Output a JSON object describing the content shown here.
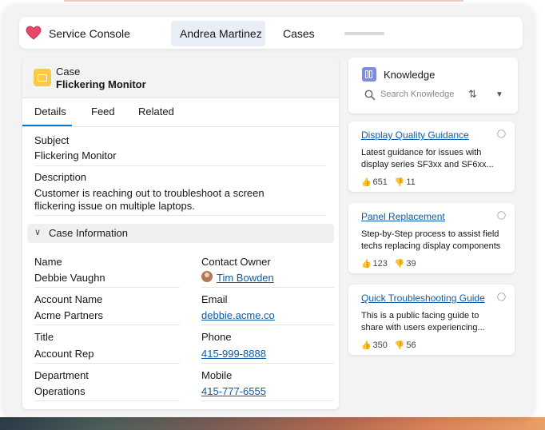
{
  "nav": {
    "app_name": "Service Console",
    "tabs": [
      {
        "label": "Andrea Martinez",
        "active": true
      },
      {
        "label": "Cases",
        "active": false
      }
    ]
  },
  "case": {
    "type": "Case",
    "title": "Flickering Monitor",
    "tabs": [
      "Details",
      "Feed",
      "Related"
    ],
    "active_tab": "Details",
    "subject": {
      "label": "Subject",
      "value": "Flickering Monitor"
    },
    "description": {
      "label": "Description",
      "lines": [
        "Customer is reaching out to troubleshoot a screen",
        "flickering issue on multiple laptops."
      ]
    },
    "section_title": "Case Information",
    "fields_left": [
      {
        "label": "Name",
        "value": "Debbie Vaughn"
      },
      {
        "label": "Account Name",
        "value": "Acme Partners"
      },
      {
        "label": "Title",
        "value": "Account Rep"
      },
      {
        "label": "Department",
        "value": "Operations"
      }
    ],
    "fields_right": [
      {
        "label": "Contact Owner",
        "value": "Tim Bowden"
      },
      {
        "label": "Email",
        "value": "debbie.acme.co"
      },
      {
        "label": "Phone",
        "value": "415-999-8888"
      },
      {
        "label": "Mobile",
        "value": "415-777-6555"
      }
    ]
  },
  "knowledge": {
    "title": "Knowledge",
    "search_placeholder": "Search Knowledge",
    "articles": [
      {
        "title": "Display Quality Guidance",
        "desc_lines": [
          "Latest guidance for issues with",
          "display series SF3xx and SF6xx..."
        ],
        "likes": "651",
        "dislikes": "11"
      },
      {
        "title": "Panel Replacement",
        "desc_lines": [
          "Step-by-Step process to assist field",
          "techs replacing display components"
        ],
        "likes": "123",
        "dislikes": "39"
      },
      {
        "title": "Quick Troubleshooting Guide",
        "desc_lines": [
          "This is a public facing guide to",
          "share with users experiencing..."
        ],
        "likes": "350",
        "dislikes": "56"
      }
    ]
  },
  "colors": {
    "accent": "#0176d3",
    "link": "#0b5cab",
    "case_icon": "#f9c94b",
    "knowledge_icon": "#7f8de1",
    "heart": "#e8476a"
  },
  "icons": {
    "app_logo": "heart-icon",
    "case": "case-icon",
    "knowledge": "knowledge-book-icon",
    "search": "search-icon",
    "sort": "sort-icon",
    "dropdown": "chevron-down-icon",
    "link": "link-icon",
    "like": "thumbs-up-icon",
    "dislike": "thumbs-down-icon"
  }
}
